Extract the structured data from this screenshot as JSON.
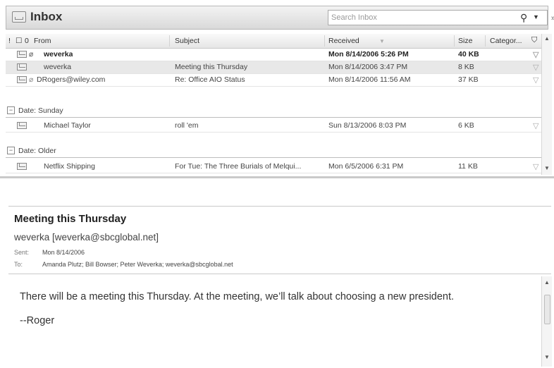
{
  "header": {
    "title": "Inbox",
    "search_placeholder": "Search Inbox"
  },
  "columns": {
    "importance": "!",
    "icon": "☐",
    "attachment": "0",
    "from": "From",
    "subject": "Subject",
    "received": "Received",
    "size": "Size",
    "categories": "Categor..."
  },
  "messages_top": [
    {
      "from": "weverka",
      "subject": "",
      "received": "Mon 8/14/2006 5:26 PM",
      "size": "40 KB",
      "unread": true,
      "attachment": true
    },
    {
      "from": "weverka",
      "subject": "Meeting this Thursday",
      "received": "Mon 8/14/2006 3:47 PM",
      "size": "8 KB",
      "unread": false,
      "attachment": false,
      "selected": true
    },
    {
      "from": "DRogers@wiley.com",
      "subject": "Re: Office AIO Status",
      "received": "Mon 8/14/2006 11:56 AM",
      "size": "37 KB",
      "unread": false,
      "attachment": true
    }
  ],
  "groups": {
    "sunday": "Date: Sunday",
    "older": "Date: Older"
  },
  "messages_sunday": [
    {
      "from": "Michael Taylor",
      "subject": "roll 'em",
      "received": "Sun 8/13/2006 8:03 PM",
      "size": "6 KB"
    }
  ],
  "messages_older": [
    {
      "from": "Netflix Shipping",
      "subject": "For Tue: The Three Burials of Melqui...",
      "received": "Mon 6/5/2006 6:31 PM",
      "size": "11 KB"
    }
  ],
  "reading_pane": {
    "subject": "Meeting this Thursday",
    "from": "weverka [weverka@sbcglobal.net]",
    "sent_label": "Sent:",
    "sent": "Mon 8/14/2006",
    "to_label": "To:",
    "to": "Amanda Plutz; Bill Bowser; Peter Weverka; weverka@sbcglobal.net",
    "body": [
      "There will be a meeting this Thursday. At the meeting, we’ll talk about choosing a new president.",
      "--Roger"
    ]
  },
  "icons": {
    "search": "search-icon",
    "flag": "flag-icon",
    "envelope": "envelope-icon"
  }
}
